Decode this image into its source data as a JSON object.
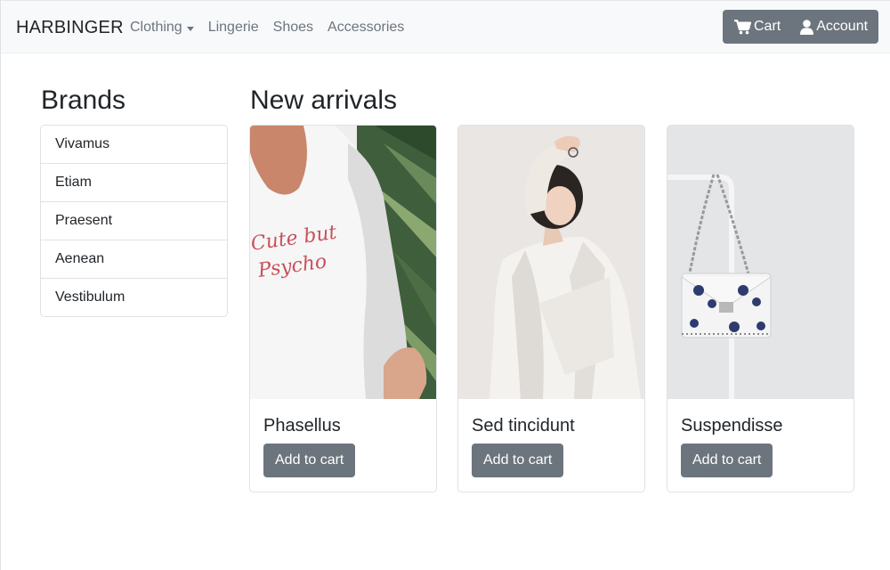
{
  "navbar": {
    "brand": "HARBINGER",
    "links": [
      {
        "label": "Clothing",
        "dropdown": true
      },
      {
        "label": "Lingerie"
      },
      {
        "label": "Shoes"
      },
      {
        "label": "Accessories"
      }
    ],
    "cart_label": "Cart",
    "account_label": "Account",
    "cart_icon": "shopping-cart-icon",
    "account_icon": "user-icon"
  },
  "sidebar": {
    "title": "Brands",
    "items": [
      "Vivamus",
      "Etiam",
      "Praesent",
      "Aenean",
      "Vestibulum"
    ]
  },
  "main": {
    "title": "New arrivals",
    "products": [
      {
        "name": "Phasellus",
        "button": "Add to cart"
      },
      {
        "name": "Sed tincidunt",
        "button": "Add to cart"
      },
      {
        "name": "Suspendisse",
        "button": "Add to cart"
      }
    ]
  },
  "colors": {
    "navbar_bg": "#f8f9fa",
    "button_bg": "#6c757d",
    "border": "#dee2e6",
    "text": "#212529",
    "muted": "#6c757d"
  }
}
